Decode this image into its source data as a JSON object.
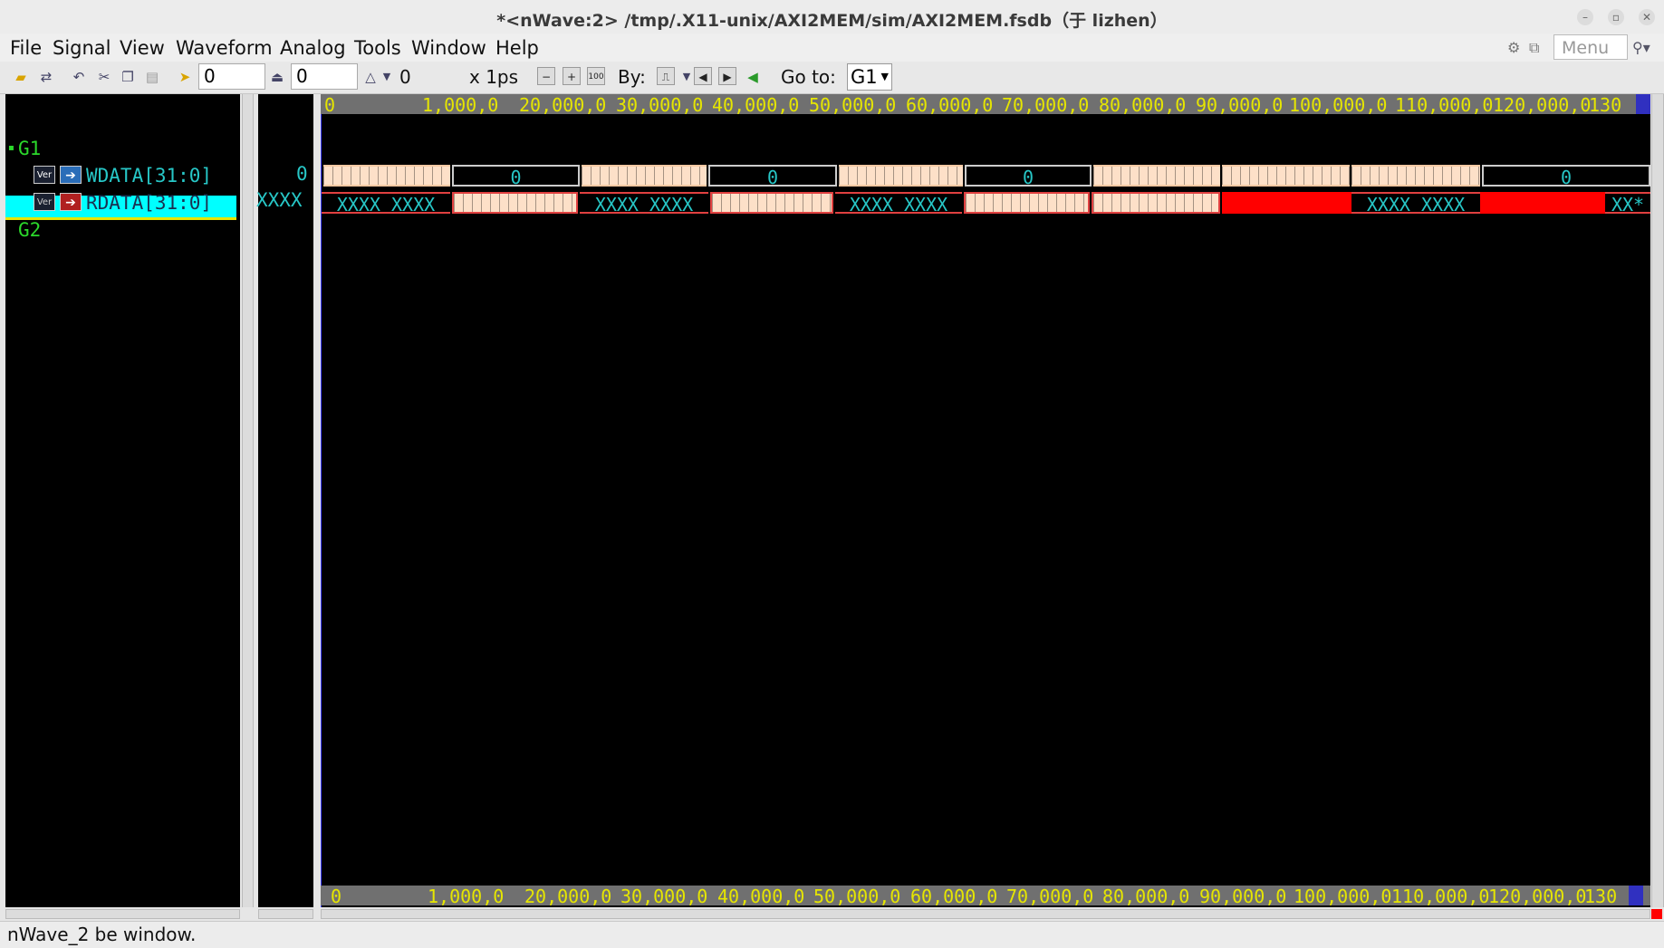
{
  "window": {
    "title": "*<nWave:2> /tmp/.X11-unix/AXI2MEM/sim/AXI2MEM.fsdb（于 lizhen）",
    "controls": [
      "–",
      "▫",
      "✕"
    ]
  },
  "menubar": {
    "items": [
      "File",
      "Signal",
      "View",
      "Waveform",
      "Analog",
      "Tools",
      "Window",
      "Help"
    ],
    "search_placeholder": "Menu"
  },
  "toolbar": {
    "cursor_value": "0",
    "marker_value": "0",
    "delta_value": "0",
    "time_unit": "x 1ps",
    "by_label": "By:",
    "goto_label": "Go to:",
    "goto_value": "G1"
  },
  "signals": {
    "groups": [
      {
        "name": "G1",
        "signals": [
          {
            "badge": "Ver",
            "name": "WDATA[31:0]",
            "value": "0",
            "selected": false
          },
          {
            "badge": "Ver",
            "name": "RDATA[31:0]",
            "value": "XXXX",
            "selected": true
          }
        ]
      },
      {
        "name": "G2",
        "signals": []
      }
    ]
  },
  "ruler": {
    "labels": [
      "0",
      "1,000,0",
      "20,000,0",
      "30,000,0",
      "40,000,0",
      "50,000,0",
      "60,000,0",
      "70,000,0",
      "80,000,0",
      "90,000,0",
      "100,000,0",
      "110,000,0",
      "120,000,0",
      "130"
    ]
  },
  "waveforms": {
    "wdata_zero_label": "0",
    "rdata_x_label": "XXXX_XXXX",
    "rdata_tail_label": "XX*"
  },
  "colors": {
    "signal_name": "#27c7c7",
    "group_name": "#2bd82b",
    "ruler_text": "#e6e600",
    "selection": "#00ffff",
    "x_state": "#ff0000"
  },
  "status": {
    "text": "nWave_2 be window."
  }
}
